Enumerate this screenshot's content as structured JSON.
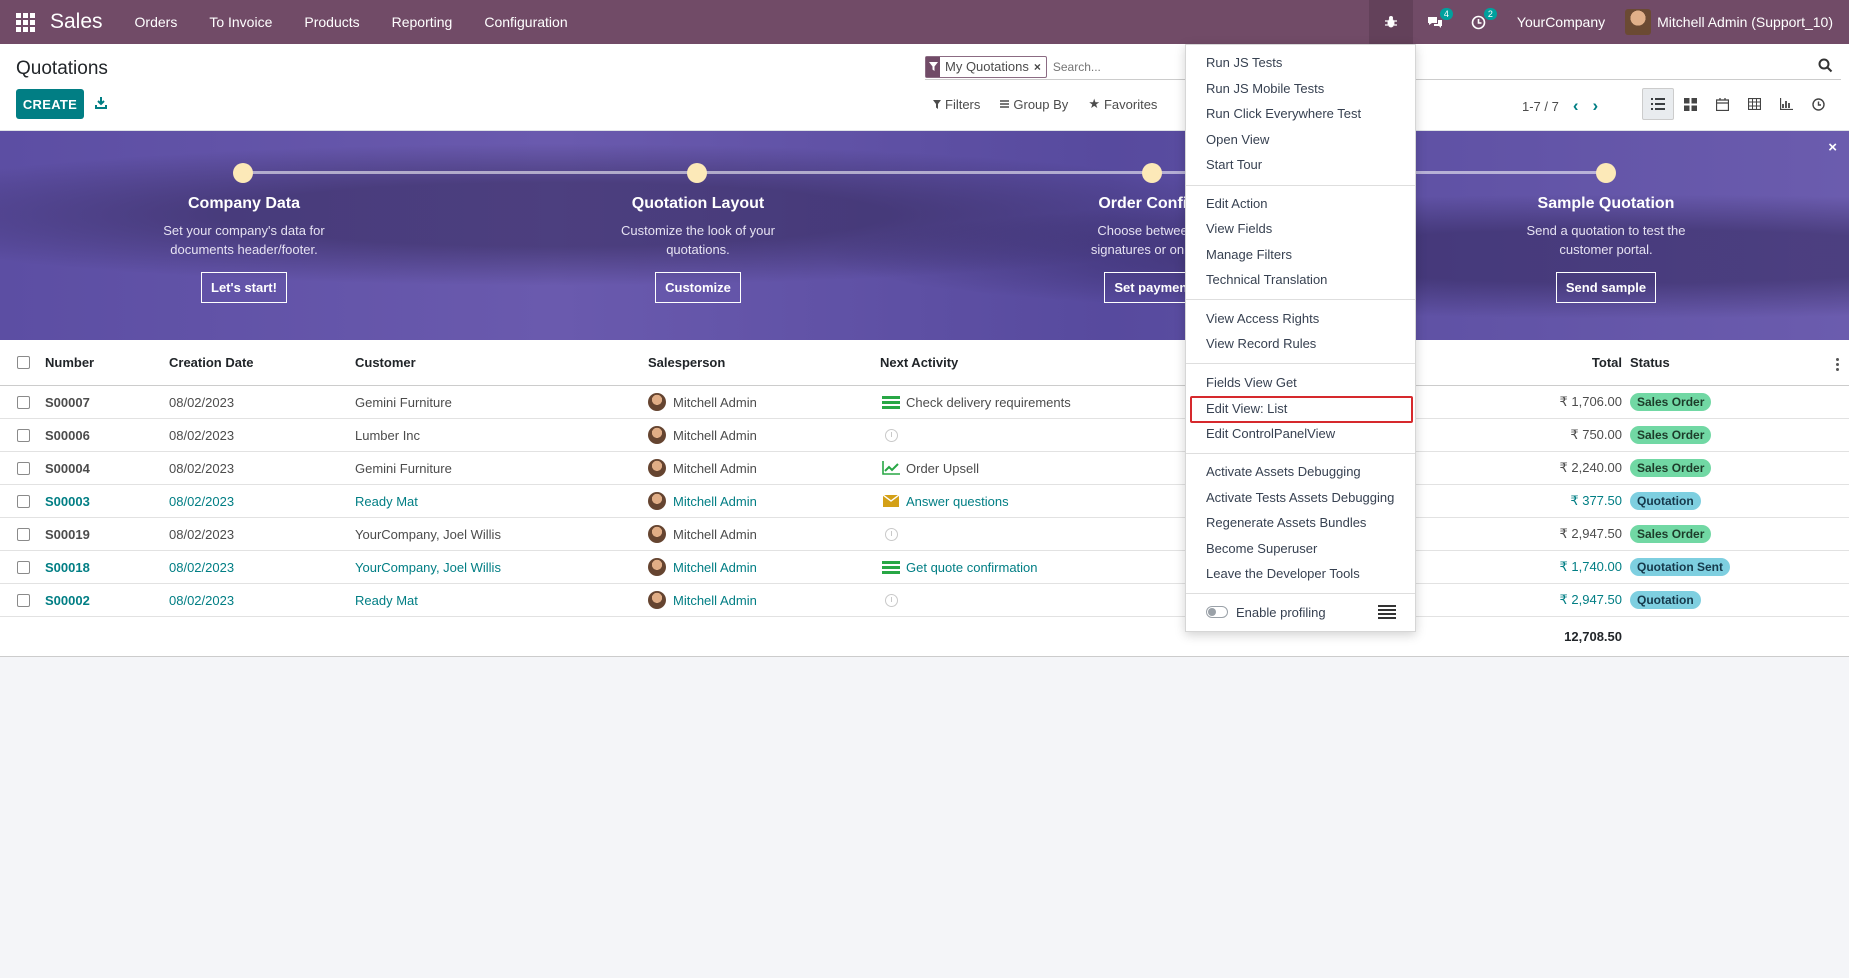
{
  "navbar": {
    "brand": "Sales",
    "menu": [
      "Orders",
      "To Invoice",
      "Products",
      "Reporting",
      "Configuration"
    ],
    "messages_count": "4",
    "activities_count": "2",
    "company": "YourCompany",
    "user": "Mitchell Admin (Support_10)"
  },
  "control_panel": {
    "title": "Quotations",
    "create_label": "CREATE",
    "facet_label": "My Quotations",
    "facet_close": "×",
    "search_placeholder": "Search...",
    "filters_label": "Filters",
    "groupby_label": "Group By",
    "favorites_label": "Favorites",
    "pager_value": "1-7 / 7"
  },
  "banner": {
    "close": "×",
    "steps": [
      {
        "title": "Company Data",
        "desc1": "Set your company's data for",
        "desc2": "documents header/footer.",
        "button": "Let's start!"
      },
      {
        "title": "Quotation Layout",
        "desc1": "Customize the look of your",
        "desc2": "quotations.",
        "button": "Customize"
      },
      {
        "title": "Order Confirm",
        "desc1": "Choose between el",
        "desc2": "signatures or online p",
        "button": "Set payment"
      },
      {
        "title": "Sample Quotation",
        "desc1": "Send a quotation to test the",
        "desc2": "customer portal.",
        "button": "Send sample"
      }
    ]
  },
  "table": {
    "headers": {
      "number": "Number",
      "date": "Creation Date",
      "customer": "Customer",
      "salesperson": "Salesperson",
      "activity": "Next Activity",
      "total": "Total",
      "status": "Status"
    },
    "rows": [
      {
        "number": "S00007",
        "date": "08/02/2023",
        "customer": "Gemini Furniture",
        "salesperson": "Mitchell Admin",
        "activity": "Check delivery requirements",
        "activity_icon": "tasks-icon",
        "total": "₹ 1,706.00",
        "status": "Sales Order"
      },
      {
        "number": "S00006",
        "date": "08/02/2023",
        "customer": "Lumber Inc",
        "salesperson": "Mitchell Admin",
        "activity": "",
        "activity_icon": "clock-icon",
        "total": "₹ 750.00",
        "status": "Sales Order"
      },
      {
        "number": "S00004",
        "date": "08/02/2023",
        "customer": "Gemini Furniture",
        "salesperson": "Mitchell Admin",
        "activity": "Order Upsell",
        "activity_icon": "chart-line-icon",
        "total": "₹ 2,240.00",
        "status": "Sales Order"
      },
      {
        "number": "S00003",
        "date": "08/02/2023",
        "customer": "Ready Mat",
        "salesperson": "Mitchell Admin",
        "activity": "Answer questions",
        "activity_icon": "envelope-icon",
        "total": "₹ 377.50",
        "status": "Quotation"
      },
      {
        "number": "S00019",
        "date": "08/02/2023",
        "customer": "YourCompany, Joel Willis",
        "salesperson": "Mitchell Admin",
        "activity": "",
        "activity_icon": "clock-icon",
        "total": "₹ 2,947.50",
        "status": "Sales Order"
      },
      {
        "number": "S00018",
        "date": "08/02/2023",
        "customer": "YourCompany, Joel Willis",
        "salesperson": "Mitchell Admin",
        "activity": "Get quote confirmation",
        "activity_icon": "tasks-icon",
        "total": "₹ 1,740.00",
        "status": "Quotation Sent"
      },
      {
        "number": "S00002",
        "date": "08/02/2023",
        "customer": "Ready Mat",
        "salesperson": "Mitchell Admin",
        "activity": "",
        "activity_icon": "clock-icon",
        "total": "₹ 2,947.50",
        "status": "Quotation"
      }
    ],
    "grand_total": "12,708.50"
  },
  "debug_menu": {
    "items": [
      "Run JS Tests",
      "Run JS Mobile Tests",
      "Run Click Everywhere Test",
      "Open View",
      "Start Tour",
      "Edit Action",
      "View Fields",
      "Manage Filters",
      "Technical Translation",
      "View Access Rights",
      "View Record Rules",
      "Fields View Get",
      "Edit View: List",
      "Edit ControlPanelView",
      "Activate Assets Debugging",
      "Activate Tests Assets Debugging",
      "Regenerate Assets Bundles",
      "Become Superuser",
      "Leave the Developer Tools"
    ],
    "profiling_label": "Enable profiling"
  },
  "colors": {
    "navbar": "#714b67",
    "primary": "#017e84",
    "highlight_border": "#d6292d",
    "sales_order_badge": "#71d8a4",
    "quotation_badge": "#7ecfe0"
  }
}
